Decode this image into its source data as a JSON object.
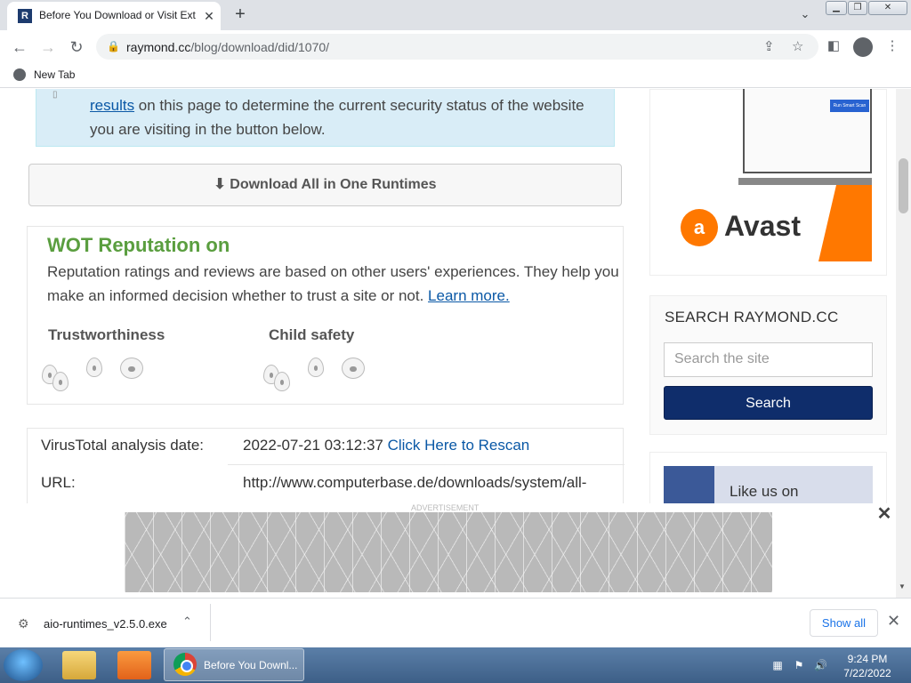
{
  "browser": {
    "tab_title": "Before You Download or Visit Ext",
    "url_domain": "raymond.cc",
    "url_path": "/blog/download/did/1070/",
    "bookmark": "New Tab"
  },
  "icons": {
    "favicon": "raymond-cc-favicon",
    "tab_close": "close-icon",
    "new_tab": "plus-icon",
    "back": "back-arrow-icon",
    "forward": "forward-arrow-icon",
    "reload": "reload-icon",
    "lock": "lock-icon",
    "share": "share-icon",
    "bookmark_star": "star-icon",
    "side_panel": "side-panel-icon",
    "profile": "avatar-icon",
    "menu": "kebab-menu-icon"
  },
  "page": {
    "info_link": "results",
    "info_text": " on this page to determine the current security status of the website you are visiting in the button below.",
    "download_button": "Download All in One Runtimes",
    "wot": {
      "title": "WOT Reputation on",
      "desc": "Reputation ratings and reviews are based on other users' experiences. They help you make an informed decision whether to trust a site or not. ",
      "learn_more": "Learn more.",
      "trust_label": "Trustworthiness",
      "child_label": "Child safety"
    },
    "virustotal": {
      "date_label": "VirusTotal analysis date:",
      "date_value": "2022-07-21 03:12:37 ",
      "rescan": "Click Here to Rescan",
      "url_label": "URL:",
      "url_value": "http://www.computerbase.de/downloads/system/all-"
    }
  },
  "sidebar": {
    "ad_brand": "Avast",
    "ad_button": "Run Smart Scan",
    "search_title": "SEARCH RAYMOND.CC",
    "search_placeholder": "Search the site",
    "search_button": "Search",
    "fb_label": "Like us on"
  },
  "ad_overlay": {
    "label": "ADVERTISEMENT"
  },
  "download_bar": {
    "file": "aio-runtimes_v2.5.0.exe",
    "show_all": "Show all"
  },
  "taskbar": {
    "chrome_label": "Before You Downl...",
    "time": "9:24 PM",
    "date": "7/22/2022"
  },
  "colors": {
    "wot_green": "#5a9e3f",
    "link_blue": "#0a58a6",
    "search_button": "#0f2d6b",
    "avast_orange": "#ff7800"
  }
}
